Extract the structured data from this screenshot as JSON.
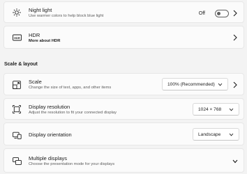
{
  "night_light": {
    "title": "Night light",
    "subtitle": "Use warmer colors to help block blue light",
    "toggle_state": "Off",
    "icon": "brightness-sun-icon"
  },
  "hdr": {
    "title": "HDR",
    "subtitle": "More about HDR",
    "icon": "hdr-icon"
  },
  "scale_layout": {
    "section_title": "Scale & layout",
    "scale": {
      "title": "Scale",
      "subtitle": "Change the size of text, apps, and other items",
      "value": "100% (Recommended)",
      "icon": "scale-icon"
    },
    "display_resolution": {
      "title": "Display resolution",
      "subtitle": "Adjust the resolution to fit your connected display",
      "value": "1024 × 768",
      "icon": "resolution-icon"
    },
    "display_orientation": {
      "title": "Display orientation",
      "value": "Landscape",
      "icon": "orientation-icon"
    }
  },
  "multiple_displays": {
    "title": "Multiple displays",
    "subtitle": "Choose the presentation mode for your displays",
    "icon": "multiple-displays-icon"
  },
  "colors": {
    "background": "#f3f3f3",
    "card": "#fbfbfb",
    "text": "#1b1b1b",
    "secondary_text": "#5c5c5c"
  }
}
